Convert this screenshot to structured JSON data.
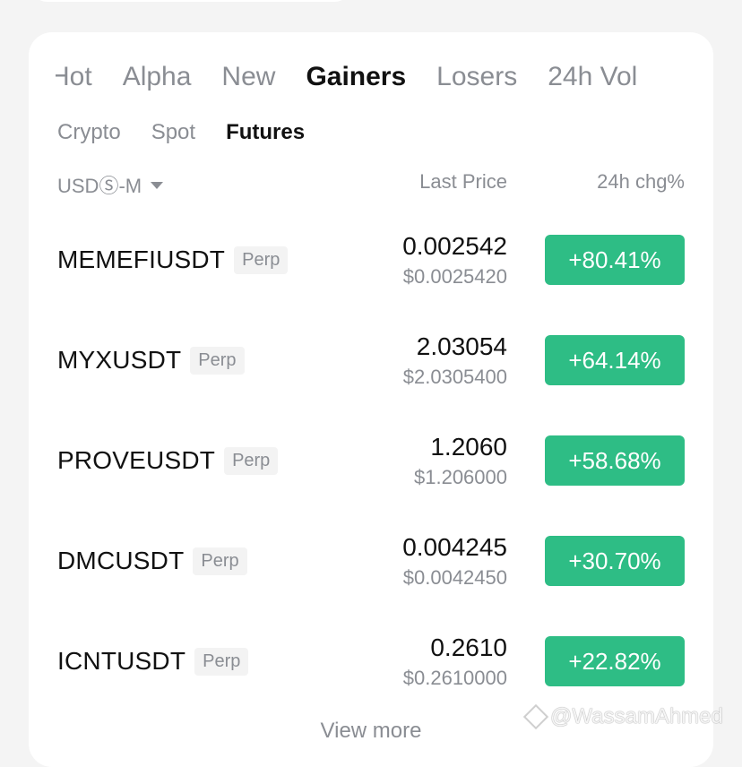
{
  "main_tabs": [
    "Hot",
    "Alpha",
    "New",
    "Gainers",
    "Losers",
    "24h Vol"
  ],
  "active_main_tab": "Gainers",
  "sub_tabs": [
    "Crypto",
    "Spot",
    "Futures"
  ],
  "active_sub_tab": "Futures",
  "table_header": {
    "market_selector": "USDⓈ-M",
    "price_label": "Last Price",
    "change_label": "24h chg%"
  },
  "rows": [
    {
      "symbol": "MEMEFIUSDT",
      "badge": "Perp",
      "price": "0.002542",
      "fiat": "$0.0025420",
      "change": "+80.41%"
    },
    {
      "symbol": "MYXUSDT",
      "badge": "Perp",
      "price": "2.03054",
      "fiat": "$2.0305400",
      "change": "+64.14%"
    },
    {
      "symbol": "PROVEUSDT",
      "badge": "Perp",
      "price": "1.2060",
      "fiat": "$1.206000",
      "change": "+58.68%"
    },
    {
      "symbol": "DMCUSDT",
      "badge": "Perp",
      "price": "0.004245",
      "fiat": "$0.0042450",
      "change": "+30.70%"
    },
    {
      "symbol": "ICNTUSDT",
      "badge": "Perp",
      "price": "0.2610",
      "fiat": "$0.2610000",
      "change": "+22.82%"
    }
  ],
  "view_more": "View more",
  "watermark": "@WassamAhmed",
  "colors": {
    "positive": "#2ebd85",
    "muted": "#8a8d93",
    "text": "#111111"
  }
}
